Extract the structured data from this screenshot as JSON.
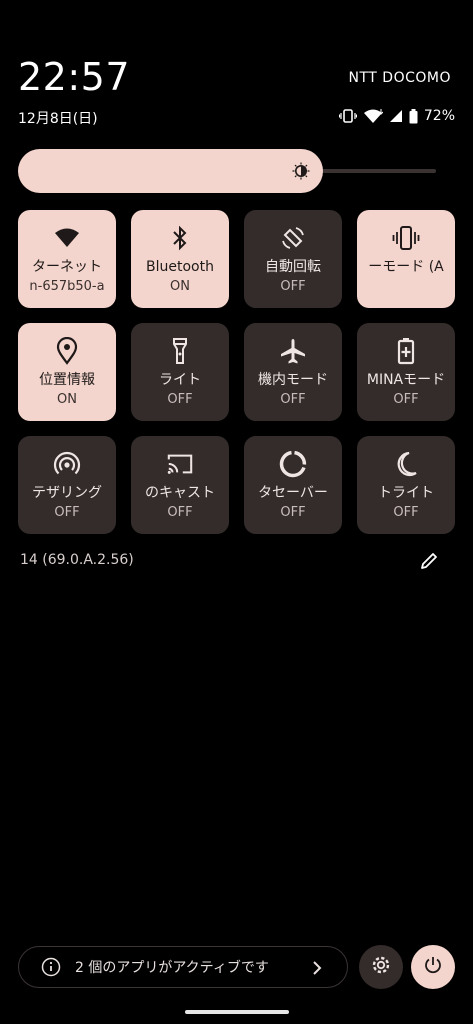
{
  "header": {
    "time": "22:57",
    "carrier": "NTT DOCOMO",
    "date": "12月8日(日)",
    "battery_percent": "72%",
    "icons": [
      "vibrate-icon",
      "wifi-icon",
      "signal-icon",
      "battery-icon"
    ]
  },
  "brightness": {
    "level": 0.72,
    "icon": "brightness-icon"
  },
  "tiles": [
    {
      "label": "ターネット",
      "state": "n-657b50-a",
      "on": true,
      "icon": "wifi-icon"
    },
    {
      "label": "Bluetooth",
      "state": "ON",
      "on": true,
      "icon": "bluetooth-icon"
    },
    {
      "label": "自動回転",
      "state": "OFF",
      "on": false,
      "icon": "auto-rotate-icon"
    },
    {
      "label": "ーモード (A",
      "state": "",
      "on": true,
      "icon": "vibrate-icon"
    },
    {
      "label": "位置情報",
      "state": "ON",
      "on": true,
      "icon": "location-icon"
    },
    {
      "label": "ライト",
      "state": "OFF",
      "on": false,
      "icon": "flashlight-icon"
    },
    {
      "label": "機内モード",
      "state": "OFF",
      "on": false,
      "icon": "airplane-icon"
    },
    {
      "label": "MINAモード",
      "state": "OFF",
      "on": false,
      "icon": "battery-saver-icon"
    },
    {
      "label": "テザリング",
      "state": "OFF",
      "on": false,
      "icon": "hotspot-icon"
    },
    {
      "label": "のキャスト",
      "state": "OFF",
      "on": false,
      "icon": "cast-icon"
    },
    {
      "label": "タセーバー",
      "state": "OFF",
      "on": false,
      "icon": "data-saver-icon"
    },
    {
      "label": "トライト",
      "state": "OFF",
      "on": false,
      "icon": "night-light-icon"
    }
  ],
  "footer": {
    "build": "14 (69.0.A.2.56)",
    "active_apps": "2 個のアプリがアクティブです"
  },
  "colors": {
    "tile_on": "#f4d5cd",
    "tile_off": "#332c2b",
    "background": "#000000"
  }
}
